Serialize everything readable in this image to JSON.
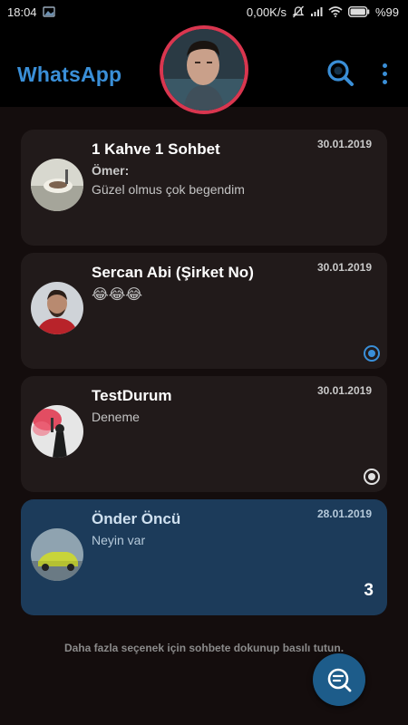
{
  "status_bar": {
    "time": "18:04",
    "network_speed": "0,00K/s",
    "battery": "%99"
  },
  "header": {
    "app_title": "WhatsApp",
    "search_icon": "search-icon",
    "menu_icon": "more-vertical-icon"
  },
  "chats": [
    {
      "name": "1 Kahve 1 Sohbet",
      "date": "30.01.2019",
      "sender": "Ömer:",
      "message": "Güzel olmus çok begendim"
    },
    {
      "name": "Sercan Abi (Şirket No)",
      "date": "30.01.2019",
      "message": "😂😂😂",
      "status": "blue-dot"
    },
    {
      "name": "TestDurum",
      "date": "30.01.2019",
      "message": "Deneme",
      "status": "white-dot"
    },
    {
      "name": "Önder Öncü",
      "date": "28.01.2019",
      "message": "Neyin var",
      "unread": "3"
    }
  ],
  "hint": "Daha fazla seçenek için sohbete dokunup basılı tutun.",
  "fab_icon": "new-chat-icon",
  "colors": {
    "accent": "#3a8fd8",
    "avatar_ring": "#d9364f",
    "highlight_card": "#1c3b5a",
    "card": "#211a1a",
    "background": "#140d0d"
  }
}
